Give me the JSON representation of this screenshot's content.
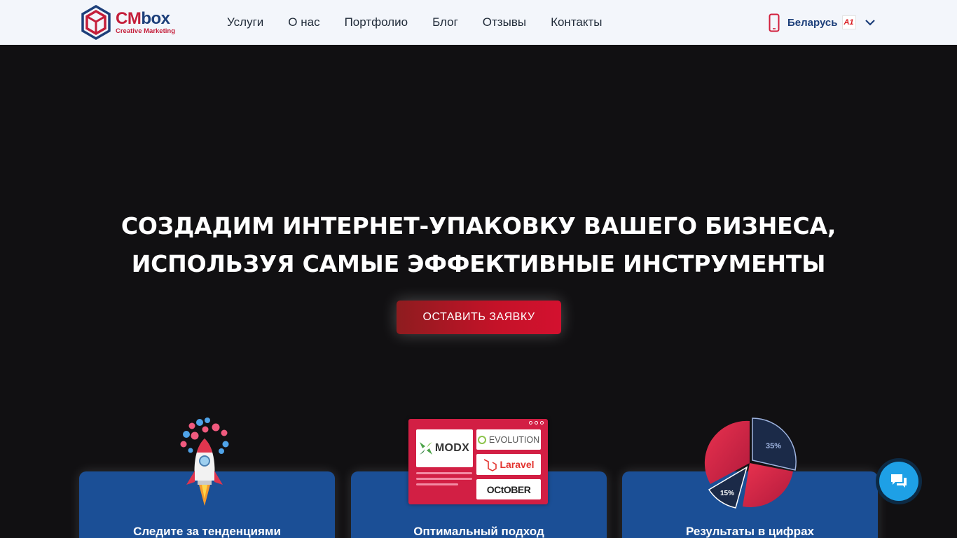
{
  "header": {
    "logo": {
      "brand_cm": "CM",
      "brand_box": "box",
      "tagline": "Creative Marketing"
    },
    "nav": [
      {
        "label": "Услуги"
      },
      {
        "label": "О нас"
      },
      {
        "label": "Портфолио"
      },
      {
        "label": "Блог"
      },
      {
        "label": "Отзывы"
      },
      {
        "label": "Контакты"
      }
    ],
    "region": {
      "label": "Беларусь",
      "badge": "A1",
      "icon": "phone-icon",
      "dropdown_icon": "chevron-down-icon"
    }
  },
  "hero": {
    "title_line1": "СОЗДАДИМ ИНТЕРНЕТ-УПАКОВКУ ВАШЕГО БИЗНЕСА,",
    "title_line2": "ИСПОЛЬЗУЯ САМЫЕ ЭФФЕКТИВНЫЕ ИНСТРУМЕНТЫ",
    "cta_label": "ОСТАВИТЬ ЗАЯВКУ"
  },
  "cards": [
    {
      "title": "Следите за тенденциями",
      "icon": "rocket-icon"
    },
    {
      "title": "Оптимальный подход",
      "icon": "cms-platforms-icon",
      "platforms": [
        "MODX",
        "EVOLUTION",
        "Laravel",
        "OCtOBER"
      ]
    },
    {
      "title": "Результаты в цифрах",
      "icon": "pie-chart-icon",
      "pie_labels": [
        "35%",
        "15%"
      ]
    }
  ],
  "chat": {
    "icon": "chat-icon"
  },
  "colors": {
    "accent": "#c41228",
    "brand_blue": "#1d3f7a",
    "card_blue": "#1b4f96",
    "chat_blue": "#1ea0e6"
  }
}
